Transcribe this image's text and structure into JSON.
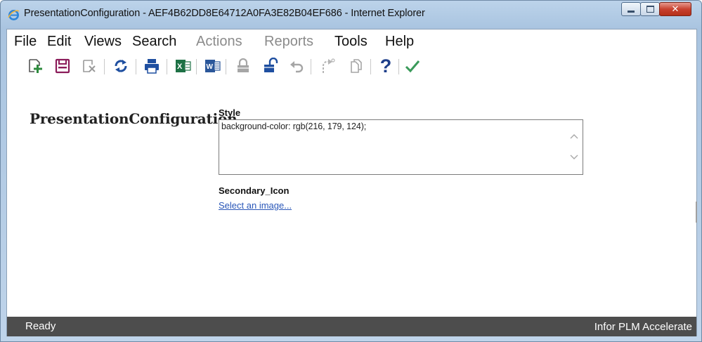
{
  "window": {
    "title": "PresentationConfiguration - AEF4B62DD8E64712A0FA3E82B04EF686 - Internet Explorer",
    "icon": "ie-icon"
  },
  "menu": {
    "file": "File",
    "edit": "Edit",
    "views": "Views",
    "search": "Search",
    "actions": "Actions",
    "reports": "Reports",
    "tools": "Tools",
    "help": "Help"
  },
  "toolbar": {
    "icons": [
      "new-icon",
      "save-icon",
      "delete-icon",
      "refresh-icon",
      "print-icon",
      "excel-icon",
      "word-icon",
      "lock-icon",
      "unlock-icon",
      "undo-icon",
      "redo-icon",
      "copy-icon",
      "help-icon",
      "check-icon"
    ],
    "help_glyph": "?",
    "check_glyph": "✓"
  },
  "page": {
    "heading": "PresentationConfiguration"
  },
  "fields": {
    "style_label": "Style",
    "style_value": "background-color: rgb(216, 179, 124);",
    "secondary_icon_label": "Secondary_Icon",
    "secondary_icon_link": "Select an image..."
  },
  "status": {
    "left": "Ready",
    "right": "Infor PLM Accelerate"
  },
  "colors": {
    "status_bg": "#4d4d4d",
    "link": "#2a57b8",
    "close_button": "#c8412f",
    "excel": "#1e7145",
    "word": "#2b579a",
    "check": "#3a9a5a"
  }
}
